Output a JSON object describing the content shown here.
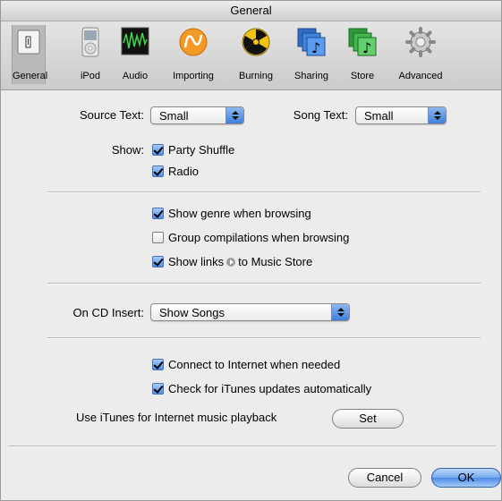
{
  "window": {
    "title": "General"
  },
  "toolbar": {
    "items": [
      {
        "label": "General",
        "icon": "general-switch-icon",
        "selected": true
      },
      {
        "label": "iPod",
        "icon": "ipod-icon"
      },
      {
        "label": "Audio",
        "icon": "audio-waveform-icon"
      },
      {
        "label": "Importing",
        "icon": "importing-icon"
      },
      {
        "label": "Burning",
        "icon": "burning-radiation-icon"
      },
      {
        "label": "Sharing",
        "icon": "sharing-music-icon"
      },
      {
        "label": "Store",
        "icon": "store-music-icon"
      },
      {
        "label": "Advanced",
        "icon": "advanced-gear-icon"
      }
    ]
  },
  "general": {
    "source_text_label": "Source Text:",
    "source_text_value": "Small",
    "song_text_label": "Song Text:",
    "song_text_value": "Small",
    "show_label": "Show:",
    "party_shuffle_label": "Party Shuffle",
    "party_shuffle_checked": true,
    "radio_label": "Radio",
    "radio_checked": true,
    "show_genre_label": "Show genre when browsing",
    "show_genre_checked": true,
    "group_compilations_label": "Group compilations when browsing",
    "group_compilations_checked": false,
    "show_links_label_before": "Show links",
    "show_links_label_after": "to Music Store",
    "show_links_checked": true,
    "cd_insert_label": "On CD Insert:",
    "cd_insert_value": "Show Songs",
    "connect_internet_label": "Connect to Internet when needed",
    "connect_internet_checked": true,
    "check_updates_label": "Check for iTunes updates automatically",
    "check_updates_checked": true,
    "internet_playback_label": "Use iTunes for Internet music playback",
    "set_button_label": "Set"
  },
  "footer": {
    "cancel_label": "Cancel",
    "ok_label": "OK"
  },
  "colors": {
    "accent_blue": "#4b8ae6",
    "window_bg": "#ececec"
  }
}
